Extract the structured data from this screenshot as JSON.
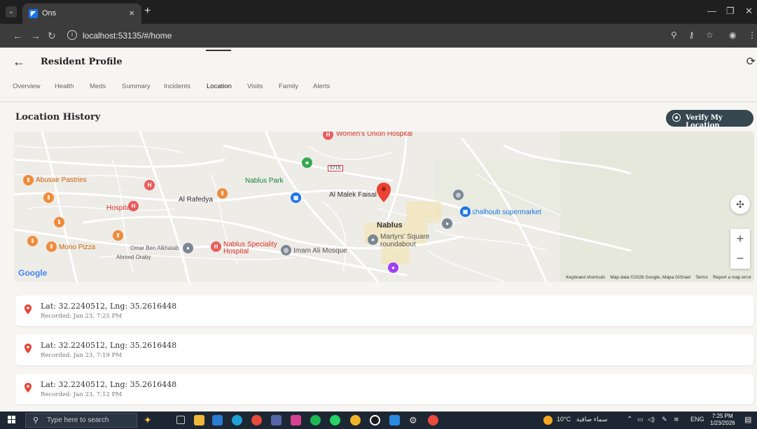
{
  "browser": {
    "tab_title": "Ons",
    "url": "localhost:53135/#/home"
  },
  "header": {
    "title": "Resident Profile"
  },
  "tabs": [
    {
      "label": "Overview"
    },
    {
      "label": "Health"
    },
    {
      "label": "Meds"
    },
    {
      "label": "Summary"
    },
    {
      "label": "Incidents"
    },
    {
      "label": "Location"
    },
    {
      "label": "Visits"
    },
    {
      "label": "Family"
    },
    {
      "label": "Alerts"
    }
  ],
  "active_tab": "Location",
  "section": {
    "title": "Location History",
    "verify_button": "Verify My Location"
  },
  "map": {
    "labels": {
      "womens_hospital": "Women's Union Hospital",
      "abusair": "Abusair Pastries",
      "nablus_park": "Nablus Park",
      "hospital": "Hospital",
      "rafedya": "Al Rafedya",
      "nablus": "Nablus",
      "shalhoub": "shalhoub supermarket",
      "martyrs": "Martyrs' Square",
      "roundabout": "roundabout",
      "mono_pizza": "Mono Pizza",
      "omar": "Omar Ben Alkhatab",
      "ahmed": "Ahmed Oraby",
      "nablus_specialty_1": "Nablus Speciality",
      "nablus_specialty_2": "Hospital",
      "imam": "Imam Ali Mosque",
      "malek_faisal": "Al Malek Faisal",
      "road_5715": "5715",
      "google": "Google"
    },
    "footer": {
      "shortcuts": "Keyboard shortcuts",
      "data": "Map data ©2026 Google, Mapa GISrael",
      "terms": "Terms",
      "report": "Report a map error"
    }
  },
  "locations": [
    {
      "coords": "Lat: 32.2240512, Lng: 35.2616448",
      "recorded": "Recorded: Jan 23, 7:25 PM"
    },
    {
      "coords": "Lat: 32.2240512, Lng: 35.2616448",
      "recorded": "Recorded: Jan 23, 7:19 PM"
    },
    {
      "coords": "Lat: 32.2240512, Lng: 35.2616448",
      "recorded": "Recorded: Jan 23, 7:12 PM"
    }
  ],
  "taskbar": {
    "search_placeholder": "Type here to search",
    "weather": "10°C",
    "weather_desc": "سماء صافية",
    "lang": "ENG",
    "time": "7:25 PM",
    "date": "1/23/2026"
  },
  "colors": {
    "accent_dark": "#37474f",
    "pin_red": "#ea4335",
    "background": "#f6f5f1"
  }
}
